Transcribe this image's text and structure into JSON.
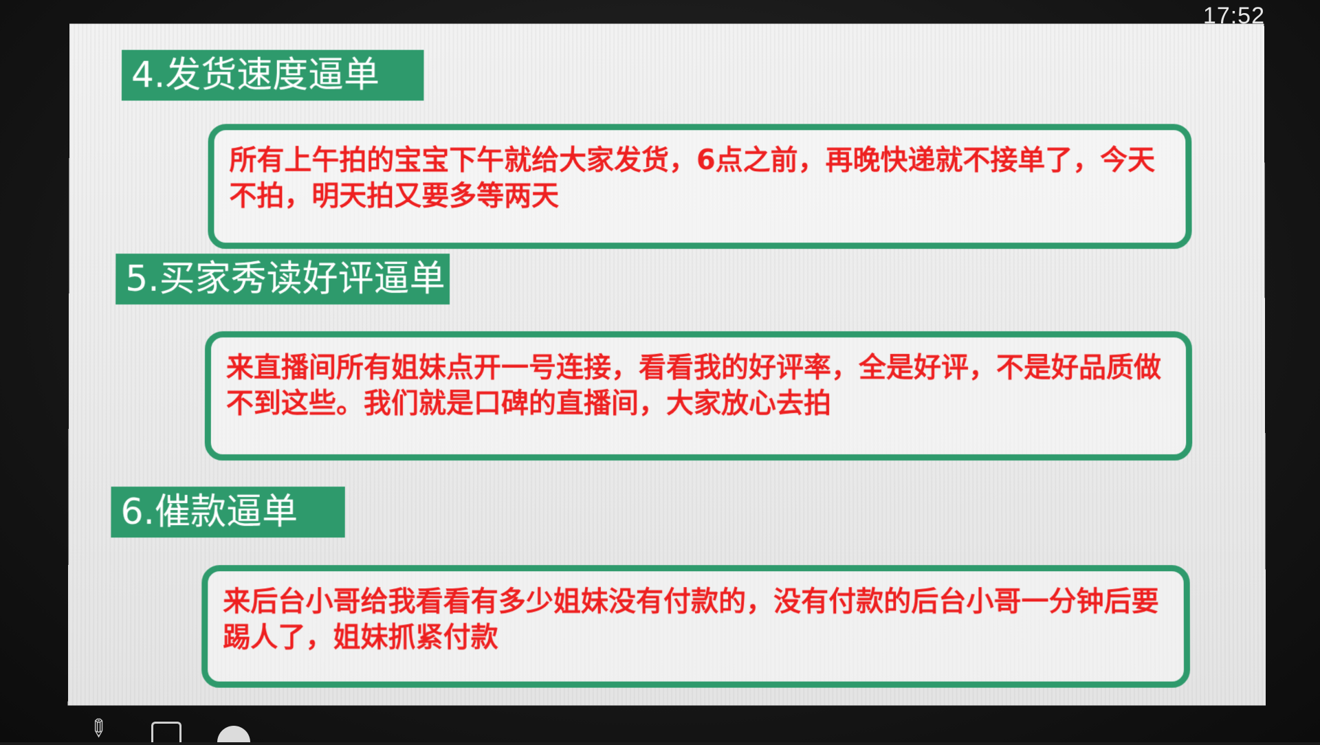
{
  "status_bar": {
    "time": "17:52"
  },
  "slide": {
    "sections": [
      {
        "header": "4.发货速度逼单",
        "body": "所有上午拍的宝宝下午就给大家发货，6点之前，再晚快递就不接单了，今天不拍，明天拍又要多等两天"
      },
      {
        "header": "5.买家秀读好评逼单",
        "body": "来直播间所有姐妹点开一号连接，看看我的好评率，全是好评，不是好品质做不到这些。我们就是口碑的直播间，大家放心去拍"
      },
      {
        "header": "6.催款逼单",
        "body": "来后台小哥给我看看有多少姐妹没有付款的，没有付款的后台小哥一分钟后要踢人了，姐妹抓紧付款"
      }
    ]
  },
  "toolbar": {
    "icons": [
      "pen-icon",
      "screenshot-icon",
      "circle-icon"
    ]
  },
  "colors": {
    "accent_green": "#2e9a6c",
    "body_text_red": "#ee2020",
    "header_text": "#ffffff"
  }
}
